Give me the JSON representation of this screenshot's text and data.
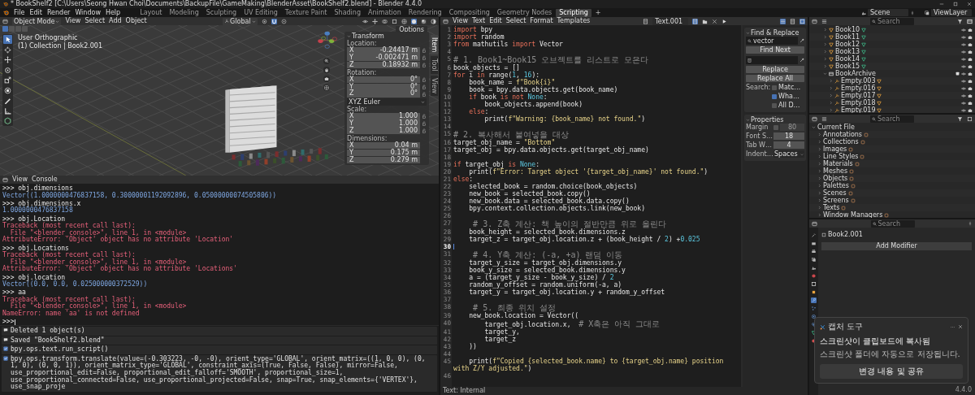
{
  "window": {
    "title": "* BookShelf2 [C:\\Users\\Seong Hwan Choi\\Documents\\BackupFile\\GameMaking\\BlenderAsset\\BookShelf2.blend] - Blender 4.4.0"
  },
  "menu": [
    "File",
    "Edit",
    "Render",
    "Window",
    "Help"
  ],
  "workspaces": [
    {
      "label": "Layout",
      "selected": false
    },
    {
      "label": "Modeling",
      "selected": false
    },
    {
      "label": "Sculpting",
      "selected": false
    },
    {
      "label": "UV Editing",
      "selected": false
    },
    {
      "label": "Texture Paint",
      "selected": false
    },
    {
      "label": "Shading",
      "selected": false
    },
    {
      "label": "Animation",
      "selected": false
    },
    {
      "label": "Rendering",
      "selected": false
    },
    {
      "label": "Compositing",
      "selected": false
    },
    {
      "label": "Geometry Nodes",
      "selected": false
    },
    {
      "label": "Scripting",
      "selected": true
    }
  ],
  "add_workspace": "+",
  "scene": "Scene",
  "view_layer": "ViewLayer",
  "viewport": {
    "mode": "Object Mode",
    "menus": [
      "View",
      "Select",
      "Add",
      "Object"
    ],
    "orientation": "Global",
    "options": "Options",
    "view_name": "User Orthographic",
    "collection_info": "(1) Collection | Book2.001",
    "tools": [
      {
        "kind": "select",
        "selected": true
      },
      {
        "kind": "cursor",
        "selected": false
      },
      {
        "kind": "move",
        "selected": false
      },
      {
        "kind": "rotate",
        "selected": false
      },
      {
        "kind": "scale",
        "selected": false
      },
      {
        "kind": "transform",
        "selected": false
      },
      {
        "kind": "annotate",
        "selected": false
      },
      {
        "kind": "measure",
        "selected": false
      },
      {
        "kind": "add_cube",
        "selected": false
      }
    ],
    "shading": [
      {
        "selected": false
      },
      {
        "selected": true
      },
      {
        "selected": false
      },
      {
        "selected": false
      }
    ],
    "sidebar_tabs": [
      {
        "label": "Item",
        "selected": true
      },
      {
        "label": "Tool",
        "selected": false
      },
      {
        "label": "View",
        "selected": false
      }
    ],
    "transform": {
      "title": "Transform",
      "rotation_mode": "XYZ Euler",
      "sections": [
        {
          "label": "Location:",
          "lockable": true,
          "fields": [
            {
              "axis": "X",
              "value": "-0.24417 m"
            },
            {
              "axis": "Y",
              "value": "-0.002471 m"
            },
            {
              "axis": "Z",
              "value": "0.18932 m"
            }
          ]
        },
        {
          "label": "Rotation:",
          "lockable": true,
          "fields": [
            {
              "axis": "X",
              "value": "0°"
            },
            {
              "axis": "Y",
              "value": "0°"
            },
            {
              "axis": "Z",
              "value": "0°"
            }
          ]
        },
        {
          "label": "Scale:",
          "lockable": true,
          "fields": [
            {
              "axis": "X",
              "value": "1.000"
            },
            {
              "axis": "Y",
              "value": "1.000"
            },
            {
              "axis": "Z",
              "value": "1.000"
            }
          ]
        },
        {
          "label": "Dimensions:",
          "lockable": false,
          "fields": [
            {
              "axis": "X",
              "value": "0.04 m"
            },
            {
              "axis": "Y",
              "value": "0.175 m"
            },
            {
              "axis": "Z",
              "value": "0.279 m"
            }
          ]
        }
      ]
    }
  },
  "console": {
    "menus": [
      "View",
      "Console"
    ],
    "prompt": ">>>",
    "entries": [
      {
        "input": ">>> obj.dimensions",
        "output": [
          {
            "kind": "result",
            "text": "Vector((1.0000000476837158, 0.30000001192092896, 0.05000000074505806))"
          }
        ]
      },
      {
        "input": ">>> obj.dimensions.x",
        "output": [
          {
            "kind": "result",
            "text": "1.0000000476837158"
          }
        ]
      },
      {
        "input": ">>> obj.Location",
        "output": [
          {
            "kind": "error",
            "text": "Traceback (most recent call last):"
          },
          {
            "kind": "error",
            "text": "  File \"<blender_console>\", line 1, in <module>"
          },
          {
            "kind": "error",
            "text": "AttributeError: 'Object' object has no attribute 'Location'"
          }
        ]
      },
      {
        "input": ">>> obj.Locations",
        "output": [
          {
            "kind": "error",
            "text": "Traceback (most recent call last):"
          },
          {
            "kind": "error",
            "text": "  File \"<blender_console>\", line 1, in <module>"
          },
          {
            "kind": "error",
            "text": "AttributeError: 'Object' object has no attribute 'Locations'"
          }
        ]
      },
      {
        "input": ">>> obj.location",
        "output": [
          {
            "kind": "result",
            "text": "Vector((0.0, 0.0, 0.025000000372529))"
          }
        ]
      },
      {
        "input": ">>> aa",
        "output": [
          {
            "kind": "error",
            "text": "Traceback (most recent call last):"
          },
          {
            "kind": "error",
            "text": "  File \"<blender_console>\", line 1, in <module>"
          },
          {
            "kind": "error",
            "text": "NameError: name 'aa' is not defined"
          }
        ]
      }
    ]
  },
  "info_log": [
    {
      "kind": "report",
      "lines": [
        "Deleted 1 object(s)"
      ]
    },
    {
      "kind": "report",
      "lines": [
        "Saved \"BookShelf2.blend\""
      ]
    },
    {
      "kind": "operator",
      "lines": [
        "bpy.ops.text.run_script()"
      ]
    },
    {
      "kind": "operator",
      "lines": [
        "bpy.ops.transform.translate(value=(-0.303223, -0, -0), orient_type='GLOBAL', orient_matrix=((1, 0, 0), (0, 1, 0), (0, 0, 1)), orient_matrix_type='GLOBAL', constraint_axis=(True, False, False), mirror=False,",
        "use_proportional_edit=False, proportional_edit_falloff='SMOOTH', proportional_size=1, use_proportional_connected=False, use_proportional_projected=False, snap=True, snap_elements={'VERTEX'}, use_snap_proje"
      ]
    }
  ],
  "text_editor": {
    "menus": [
      "View",
      "Text",
      "Edit",
      "Select",
      "Format",
      "Templates"
    ],
    "file": "Text.001",
    "view_toggles": [
      {
        "on": true
      },
      {
        "on": false
      },
      {
        "on": true
      }
    ],
    "footer": "Text: Internal",
    "lines": [
      {
        "n": "1",
        "current": false,
        "spans": [
          {
            "kind": "keyword",
            "text": "import"
          },
          {
            "kind": "plain",
            "text": " bpy"
          }
        ]
      },
      {
        "n": "2",
        "current": false,
        "spans": [
          {
            "kind": "keyword",
            "text": "import"
          },
          {
            "kind": "plain",
            "text": " random"
          }
        ]
      },
      {
        "n": "3",
        "current": false,
        "spans": [
          {
            "kind": "keyword",
            "text": "from"
          },
          {
            "kind": "plain",
            "text": " mathutils "
          },
          {
            "kind": "keyword",
            "text": "import"
          },
          {
            "kind": "plain",
            "text": " Vector"
          }
        ]
      },
      {
        "n": "4",
        "current": false
      },
      {
        "n": "5",
        "current": false,
        "spans": [
          {
            "kind": "comment",
            "text": "# 1. Book1~Book15 오브젝트를 리스트로 모은다"
          }
        ]
      },
      {
        "n": "6",
        "current": false,
        "spans": [
          {
            "kind": "plain",
            "text": "book_objects = []"
          }
        ]
      },
      {
        "n": "7",
        "current": false,
        "spans": [
          {
            "kind": "keyword",
            "text": "for"
          },
          {
            "kind": "plain",
            "text": " i "
          },
          {
            "kind": "keyword",
            "text": "in"
          },
          {
            "kind": "plain",
            "text": " range("
          },
          {
            "kind": "number",
            "text": "1"
          },
          {
            "kind": "plain",
            "text": ", "
          },
          {
            "kind": "number",
            "text": "16"
          },
          {
            "kind": "plain",
            "text": "):"
          }
        ]
      },
      {
        "n": "8",
        "current": false,
        "spans": [
          {
            "kind": "plain",
            "text": "    book_name = "
          },
          {
            "kind": "string",
            "text": "f\"Book{i}\""
          }
        ]
      },
      {
        "n": "9",
        "current": false,
        "spans": [
          {
            "kind": "plain",
            "text": "    book = bpy.data.objects.get(book_name)"
          }
        ]
      },
      {
        "n": "10",
        "current": false,
        "spans": [
          {
            "kind": "keyword",
            "text": "    if"
          },
          {
            "kind": "plain",
            "text": " book "
          },
          {
            "kind": "keyword",
            "text": "is not "
          },
          {
            "kind": "number",
            "text": "None"
          },
          {
            "kind": "plain",
            "text": ":"
          }
        ]
      },
      {
        "n": "11",
        "current": false,
        "spans": [
          {
            "kind": "plain",
            "text": "        book_objects.append(book)"
          }
        ]
      },
      {
        "n": "12",
        "current": false,
        "spans": [
          {
            "kind": "keyword",
            "text": "    else"
          },
          {
            "kind": "plain",
            "text": ":"
          }
        ]
      },
      {
        "n": "13",
        "current": false,
        "spans": [
          {
            "kind": "plain",
            "text": "        print("
          },
          {
            "kind": "string",
            "text": "f\"Warning: {book_name} not found.\""
          },
          {
            "kind": "plain",
            "text": ")"
          }
        ]
      },
      {
        "n": "14",
        "current": false
      },
      {
        "n": "15",
        "current": false,
        "spans": [
          {
            "kind": "comment",
            "text": "# 2. 복사해서 붙여넣을 대상"
          }
        ]
      },
      {
        "n": "16",
        "current": false,
        "spans": [
          {
            "kind": "plain",
            "text": "target_obj_name = "
          },
          {
            "kind": "string",
            "text": "\"Bottom\""
          }
        ]
      },
      {
        "n": "17",
        "current": false,
        "spans": [
          {
            "kind": "plain",
            "text": "target_obj = bpy.data.objects.get(target_obj_name)"
          }
        ]
      },
      {
        "n": "18",
        "current": false
      },
      {
        "n": "19",
        "current": false,
        "spans": [
          {
            "kind": "keyword",
            "text": "if"
          },
          {
            "kind": "plain",
            "text": " target_obj "
          },
          {
            "kind": "keyword",
            "text": "is "
          },
          {
            "kind": "number",
            "text": "None"
          },
          {
            "kind": "plain",
            "text": ":"
          }
        ]
      },
      {
        "n": "20",
        "current": false,
        "spans": [
          {
            "kind": "plain",
            "text": "    print("
          },
          {
            "kind": "string",
            "text": "f\"Error: Target object '{target_obj_name}' not found.\""
          },
          {
            "kind": "plain",
            "text": ")"
          }
        ]
      },
      {
        "n": "21",
        "current": false,
        "spans": [
          {
            "kind": "keyword",
            "text": "else"
          },
          {
            "kind": "plain",
            "text": ":"
          }
        ]
      },
      {
        "n": "22",
        "current": false,
        "spans": [
          {
            "kind": "plain",
            "text": "    selected_book = random.choice(book_objects)"
          }
        ]
      },
      {
        "n": "23",
        "current": false,
        "spans": [
          {
            "kind": "plain",
            "text": "    new_book = selected_book.copy()"
          }
        ]
      },
      {
        "n": "24",
        "current": false,
        "spans": [
          {
            "kind": "plain",
            "text": "    new_book.data = selected_book.data.copy()"
          }
        ]
      },
      {
        "n": "25",
        "current": false,
        "spans": [
          {
            "kind": "plain",
            "text": "    bpy.context.collection.objects.link(new_book)"
          }
        ]
      },
      {
        "n": "26",
        "current": false
      },
      {
        "n": "27",
        "current": false,
        "spans": [
          {
            "kind": "comment",
            "text": "    # 3. Z축 계산: 책 높이의 절반만큼 위로 올린다"
          }
        ]
      },
      {
        "n": "28",
        "current": false,
        "spans": [
          {
            "kind": "plain",
            "text": "    book_height = selected_book.dimensions.z"
          }
        ]
      },
      {
        "n": "29",
        "current": false,
        "spans": [
          {
            "kind": "plain",
            "text": "    target_z = target_obj.location.z + (book_height / "
          },
          {
            "kind": "number",
            "text": "2"
          },
          {
            "kind": "plain",
            "text": ") +"
          },
          {
            "kind": "number",
            "text": "0.025"
          }
        ]
      },
      {
        "n": "30",
        "current": true
      },
      {
        "n": "31",
        "current": false,
        "spans": [
          {
            "kind": "comment",
            "text": "    # 4. Y축 계산: (-a, +a) 랜덤 이동"
          }
        ]
      },
      {
        "n": "32",
        "current": false,
        "spans": [
          {
            "kind": "plain",
            "text": "    target_y_size = target_obj.dimensions.y"
          }
        ]
      },
      {
        "n": "33",
        "current": false,
        "spans": [
          {
            "kind": "plain",
            "text": "    book_y_size = selected_book.dimensions.y"
          }
        ]
      },
      {
        "n": "34",
        "current": false,
        "spans": [
          {
            "kind": "plain",
            "text": "    a = (target_y_size - book_y_size) / "
          },
          {
            "kind": "number",
            "text": "2"
          }
        ]
      },
      {
        "n": "35",
        "current": false,
        "spans": [
          {
            "kind": "plain",
            "text": "    random_y_offset = random.uniform(-a, a)"
          }
        ]
      },
      {
        "n": "36",
        "current": false,
        "spans": [
          {
            "kind": "plain",
            "text": "    target_y = target_obj.location.y + random_y_offset"
          }
        ]
      },
      {
        "n": "37",
        "current": false
      },
      {
        "n": "38",
        "current": false,
        "spans": [
          {
            "kind": "comment",
            "text": "    # 5. 최종 위치 설정"
          }
        ]
      },
      {
        "n": "39",
        "current": false,
        "spans": [
          {
            "kind": "plain",
            "text": "    new_book.location = Vector(("
          }
        ]
      },
      {
        "n": "40",
        "current": false,
        "spans": [
          {
            "kind": "plain",
            "text": "        target_obj.location.x,  "
          },
          {
            "kind": "comment",
            "text": "# X축은 아직 그대로"
          }
        ]
      },
      {
        "n": "41",
        "current": false,
        "spans": [
          {
            "kind": "plain",
            "text": "        target_y,"
          }
        ]
      },
      {
        "n": "42",
        "current": false,
        "spans": [
          {
            "kind": "plain",
            "text": "        target_z"
          }
        ]
      },
      {
        "n": "43",
        "current": false,
        "spans": [
          {
            "kind": "plain",
            "text": "    ))"
          }
        ]
      },
      {
        "n": "44",
        "current": false
      },
      {
        "n": "45",
        "current": false,
        "spans": [
          {
            "kind": "plain",
            "text": "    print("
          },
          {
            "kind": "string",
            "text": "f\"Copied {selected_book.name} to {target_obj.name} position with Z/Y adjusted.\""
          },
          {
            "kind": "plain",
            "text": ")"
          }
        ]
      },
      {
        "n": "46",
        "current": false
      }
    ]
  },
  "find_replace": {
    "title": "Find & Replace",
    "find": "vector",
    "find_next": "Find Next",
    "replace": "Replace",
    "replace_all": "Replace All",
    "search_label": "Search:",
    "options": [
      {
        "label": "Matc…",
        "checked": false
      },
      {
        "label": "Wha…",
        "checked": true
      },
      {
        "label": "All D…",
        "checked": false
      }
    ]
  },
  "text_properties": {
    "title": "Properties",
    "rows": [
      {
        "kind": "margin",
        "label": "Margin",
        "checked": false,
        "value": "80"
      },
      {
        "kind": "number",
        "label": "Font S…",
        "value": "18"
      },
      {
        "kind": "number",
        "label": "Tab W…",
        "value": "4"
      },
      {
        "kind": "dropdown",
        "label": "Indent…",
        "value": "Spaces"
      }
    ]
  },
  "outliner": {
    "search_placeholder": "Search",
    "rows": [
      {
        "name": "Book10",
        "kind": "object",
        "expanded": false
      },
      {
        "name": "Book11",
        "kind": "object",
        "expanded": false
      },
      {
        "name": "Book12",
        "kind": "object",
        "expanded": false
      },
      {
        "name": "Book13",
        "kind": "object",
        "expanded": false
      },
      {
        "name": "Book14",
        "kind": "object",
        "expanded": false
      },
      {
        "name": "Book15",
        "kind": "object",
        "expanded": false
      },
      {
        "name": "BookArchive",
        "kind": "collection",
        "expanded": true,
        "children": [
          {
            "name": "Empty.003",
            "kind": "empty",
            "expanded": false
          },
          {
            "name": "Empty.016",
            "kind": "empty",
            "expanded": false
          },
          {
            "name": "Empty.017",
            "kind": "empty",
            "expanded": false
          },
          {
            "name": "Empty.018",
            "kind": "empty",
            "expanded": false
          },
          {
            "name": "Empty.019",
            "kind": "empty",
            "expanded": false
          }
        ]
      }
    ]
  },
  "data_api": {
    "search_placeholder": "Search",
    "root": {
      "name": "Current File",
      "expanded": true,
      "children": [
        {
          "name": "Annotations",
          "expanded": false
        },
        {
          "name": "Collections",
          "expanded": false
        },
        {
          "name": "Images",
          "expanded": false
        },
        {
          "name": "Line Styles",
          "expanded": false
        },
        {
          "name": "Materials",
          "expanded": false
        },
        {
          "name": "Meshes",
          "expanded": false
        },
        {
          "name": "Objects",
          "expanded": false
        },
        {
          "name": "Palettes",
          "expanded": false
        },
        {
          "name": "Scenes",
          "expanded": false
        },
        {
          "name": "Screens",
          "expanded": false
        },
        {
          "name": "Texts",
          "expanded": false
        },
        {
          "name": "Window Managers",
          "expanded": false
        }
      ]
    }
  },
  "properties": {
    "search_placeholder": "Search",
    "object": "Book2.001",
    "add_modifier": "Add Modifier",
    "tabs": [
      {
        "kind": "tool",
        "selected": false
      },
      {
        "kind": "render",
        "selected": false
      },
      {
        "kind": "output",
        "selected": false
      },
      {
        "kind": "view_layer",
        "selected": false
      },
      {
        "kind": "scene",
        "selected": false
      },
      {
        "kind": "world",
        "selected": false
      },
      {
        "kind": "collection",
        "selected": false
      },
      {
        "kind": "object",
        "selected": false
      },
      {
        "kind": "modifier",
        "selected": true
      },
      {
        "kind": "particles",
        "selected": false
      },
      {
        "kind": "physics",
        "selected": false
      },
      {
        "kind": "constraints",
        "selected": false
      },
      {
        "kind": "data",
        "selected": false
      },
      {
        "kind": "material",
        "selected": false
      }
    ]
  },
  "notification": {
    "app": "캡처 도구",
    "title": "스크린샷이 클립보드에 복사됨",
    "message": "스크린샷 폴더에 자동으로 저장됩니다.",
    "action": "변경 내용 및 공유"
  },
  "status_bar": {
    "version": "4.4.0"
  }
}
